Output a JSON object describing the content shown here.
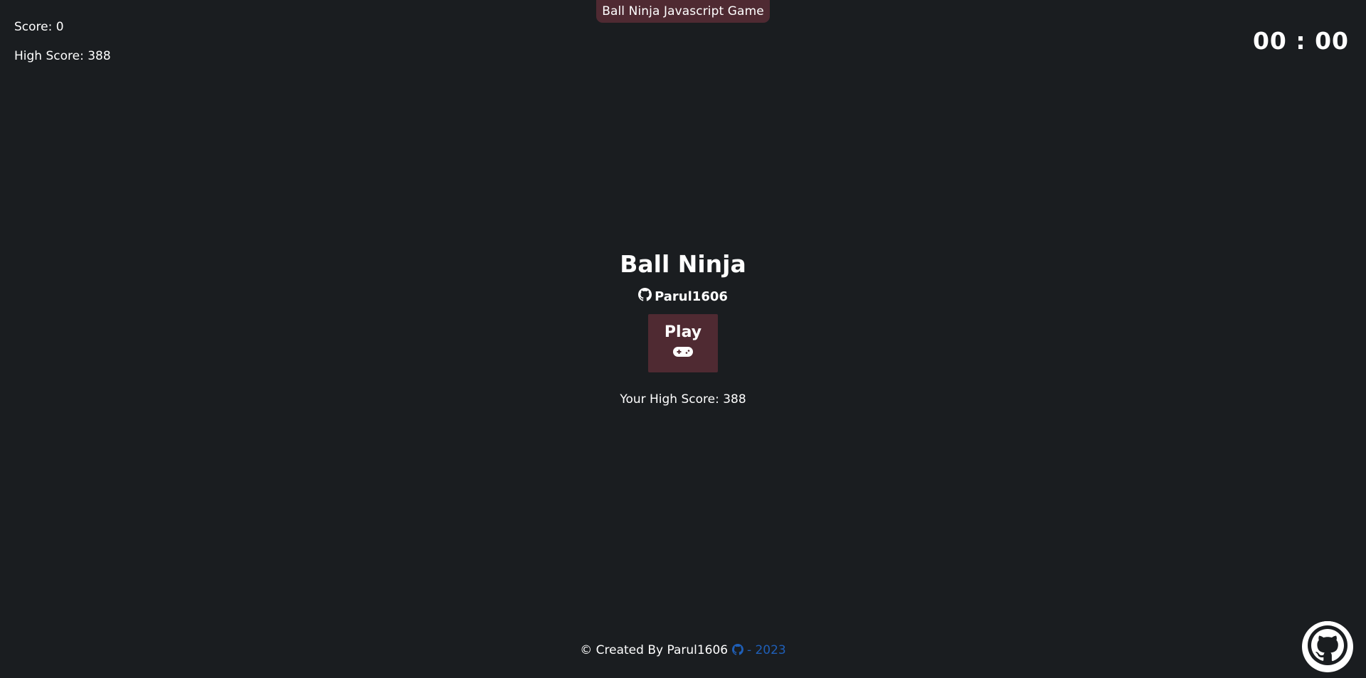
{
  "banner": {
    "text": "Ball Ninja Javascript Game"
  },
  "hud": {
    "score": "Score: 0",
    "high_score": "High Score: 388",
    "timer": "00 : 00"
  },
  "menu": {
    "title": "Ball Ninja",
    "author": "Parul1606",
    "play_label": "Play",
    "your_high_score": "Your High Score: 388"
  },
  "footer": {
    "created_by": "© Created By Parul1606",
    "year_text": "- 2023"
  },
  "colors": {
    "background": "#1a1d20",
    "accent": "#4f2a32",
    "link": "#1f5fb8",
    "text": "#ffffff"
  },
  "icons": {
    "author": "github-icon",
    "play": "gamepad-icon",
    "footer": "github-icon",
    "corner": "github-octocat-icon"
  }
}
